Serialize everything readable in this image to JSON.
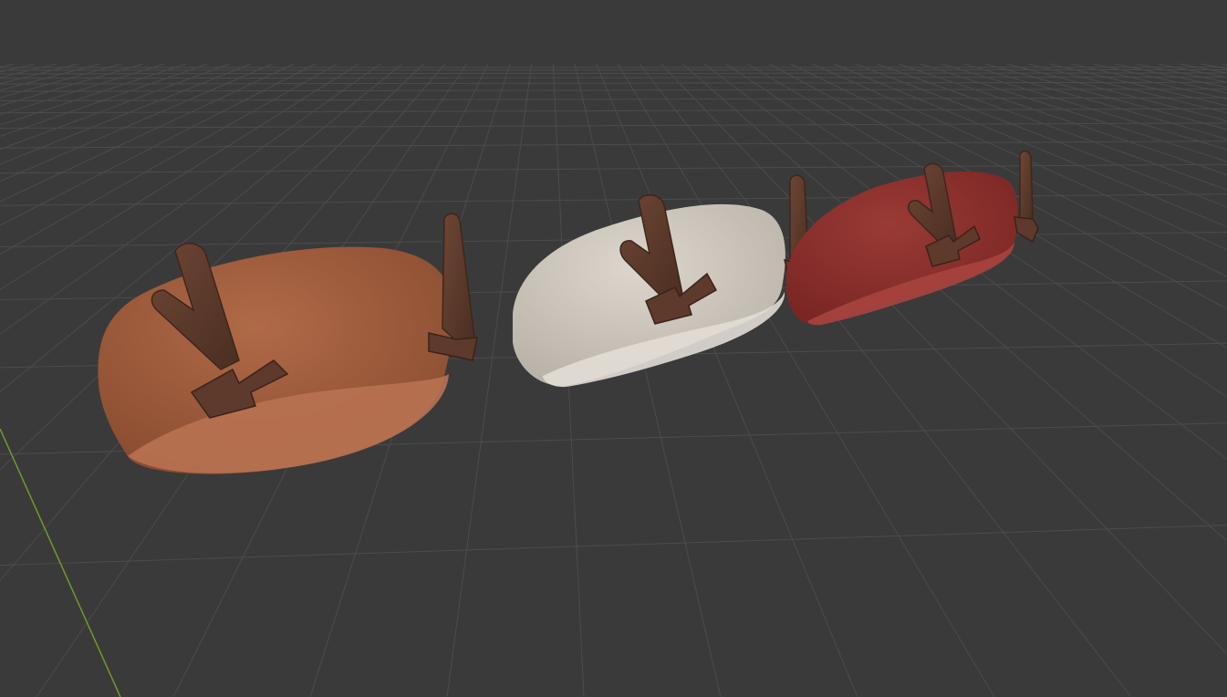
{
  "viewport": {
    "background_color": "#3a3a3a",
    "grid_color": "#4c4c4c",
    "y_axis_color": "#6f9a2a",
    "grid_visible": true
  },
  "scene_objects": [
    {
      "name": "beret-brown",
      "felt_color": "#a05c3c",
      "rim_color": "#b46d4a",
      "accent_color": "#5a382a"
    },
    {
      "name": "beret-cream",
      "felt_color": "#cfc8be",
      "rim_color": "#ddd7ce",
      "accent_color": "#5a382a"
    },
    {
      "name": "beret-red",
      "felt_color": "#8c2e2c",
      "rim_color": "#a0403c",
      "accent_color": "#5a382a"
    }
  ]
}
